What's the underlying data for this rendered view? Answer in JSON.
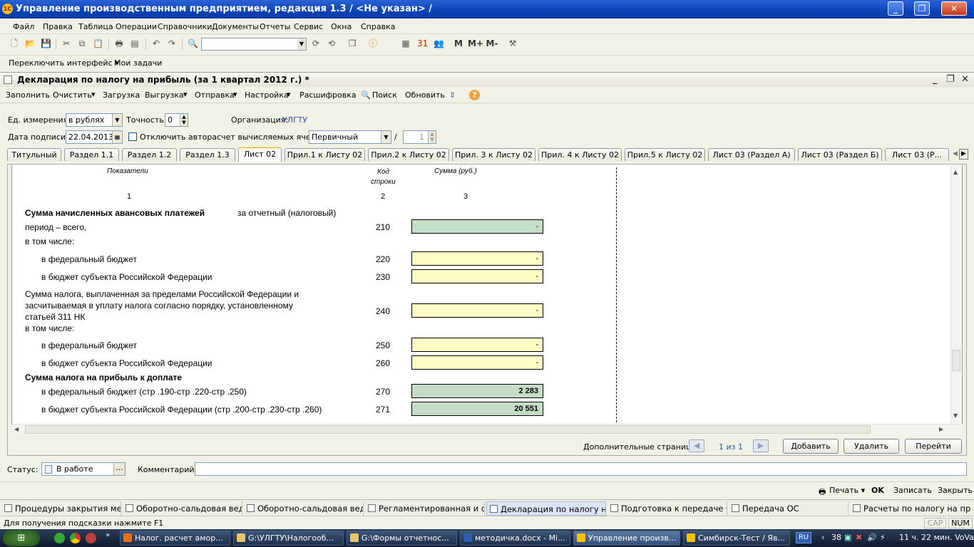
{
  "app": {
    "title": "Управление производственным предприятием, редакция 1.3 / <Не указан> /",
    "logo": "1С"
  },
  "menu": [
    "Файл",
    "Правка",
    "Таблица",
    "Операции",
    "Справочники",
    "Документы",
    "Отчеты",
    "Сервис",
    "Окна",
    "Справка"
  ],
  "memory_buttons": [
    "M",
    "M+",
    "M-"
  ],
  "toolbar2": {
    "switch_interface": "Переключить интерфейс",
    "my_tasks": "Мои задачи"
  },
  "document": {
    "title": "Декларация по налогу на прибыль (за 1 квартал 2012 г.) *",
    "commands": [
      "Заполнить",
      "Очистить",
      "Загрузка",
      "Выгрузка",
      "Отправка",
      "Настройка",
      "Расшифровка",
      "Поиск",
      "Обновить"
    ],
    "unit_label": "Ед. измерения:",
    "unit_value": "в рублях",
    "precision_label": "Точность:",
    "precision_value": "0",
    "org_label": "Организация:",
    "org_value": "УЛГТУ",
    "sign_date_label": "Дата подписи:",
    "sign_date_value": "22.04.2013",
    "autocalc_label": "Отключить авторасчет вычисляемых ячеек",
    "kind_value": "Первичный",
    "slash": "/",
    "correction_number": "1",
    "tabs": [
      "Титульный",
      "Раздел 1.1",
      "Раздел 1.2",
      "Раздел 1.3",
      "Лист 02",
      "Прил.1 к Листу 02",
      "Прил.2 к Листу 02",
      "Прил. 3 к Листу 02",
      "Прил. 4 к Листу 02",
      "Прил.5 к Листу 02",
      "Лист 03 (Раздел А)",
      "Лист 03 (Раздел Б)",
      "Лист 03 (Р..."
    ],
    "active_tab": "Лист 02",
    "sheet": {
      "col1_header": "Показатели",
      "col2_header": "Код",
      "col2_header2": "строки",
      "col3_header": "Сумма (руб.)",
      "col_nums": [
        "1",
        "2",
        "3"
      ],
      "rows": [
        {
          "text": "Сумма начисленных авансовых платежей",
          "text2": "за отчетный (налоговый)",
          "text3": "период – всего,",
          "code": "210",
          "value": "-"
        },
        {
          "text": "в том числе:"
        },
        {
          "text": "в федеральный бюджет",
          "code": "220",
          "value": "-"
        },
        {
          "text": "в бюджет субъекта Российской Федерации",
          "code": "230",
          "value": "-"
        },
        {
          "text": "Сумма налога, выплаченная за пределами Российской Федерации и",
          "text2": "засчитываемая в уплату налога согласно порядку, установленному",
          "text3": "статьей 311 НК",
          "code": "240",
          "value": "-"
        },
        {
          "text": "в том числе:"
        },
        {
          "text": "в федеральный бюджет",
          "code": "250",
          "value": "-"
        },
        {
          "text": "в бюджет субъекта Российской Федерации",
          "code": "260",
          "value": "-"
        },
        {
          "text": "Сумма налога на прибыль к доплате"
        },
        {
          "text": "в федеральный бюджет (стр .190-стр .220-стр .250)",
          "code": "270",
          "value": "2 283"
        },
        {
          "text": "в бюджет субъекта Российской Федерации (стр .200-стр .230-стр .260)",
          "code": "271",
          "value": "20 551"
        }
      ]
    },
    "extra_pages_label": "Дополнительные страницы:",
    "extra_pages_counter": "1 из 1",
    "buttons": {
      "add": "Добавить",
      "delete": "Удалить",
      "go": "Перейти"
    },
    "status_label": "Статус:",
    "status_value": "В работе",
    "status_more": "...",
    "comment_label": "Комментарий:",
    "comment_value": "",
    "bottom": {
      "print": "Печать",
      "ok": "OK",
      "save": "Записать",
      "close": "Закрыть"
    }
  },
  "window_bar": [
    "Процедуры закрытия меся...",
    "Оборотно-сальдовая ведо...",
    "Оборотно-сальдовая ведо...",
    "Регламентированная и фи...",
    "Декларация по налогу на ...",
    "Подготовка к передаче ОС",
    "Передача ОС",
    "Расчеты по налогу на приб..."
  ],
  "status_hint": "Для получения подсказки нажмите F1",
  "status_indicators": [
    "CAP",
    "NUM"
  ],
  "taskbar": {
    "items": [
      "Налог. расчет амор...",
      "G:\\УЛГТУ\\Налогооб...",
      "G:\\Формы отчетнос...",
      "методичка.docx - Mi...",
      "Управление произв...",
      "Симбирск-Тест / Яв..."
    ],
    "lang": "RU",
    "clock": "11 ч. 22 мин. VoVa",
    "tray_num": "38"
  },
  "colors": {
    "titlebar": "#0d43b8",
    "computed_cell": "#c4dec6",
    "input_cell": "#fefcc4"
  }
}
